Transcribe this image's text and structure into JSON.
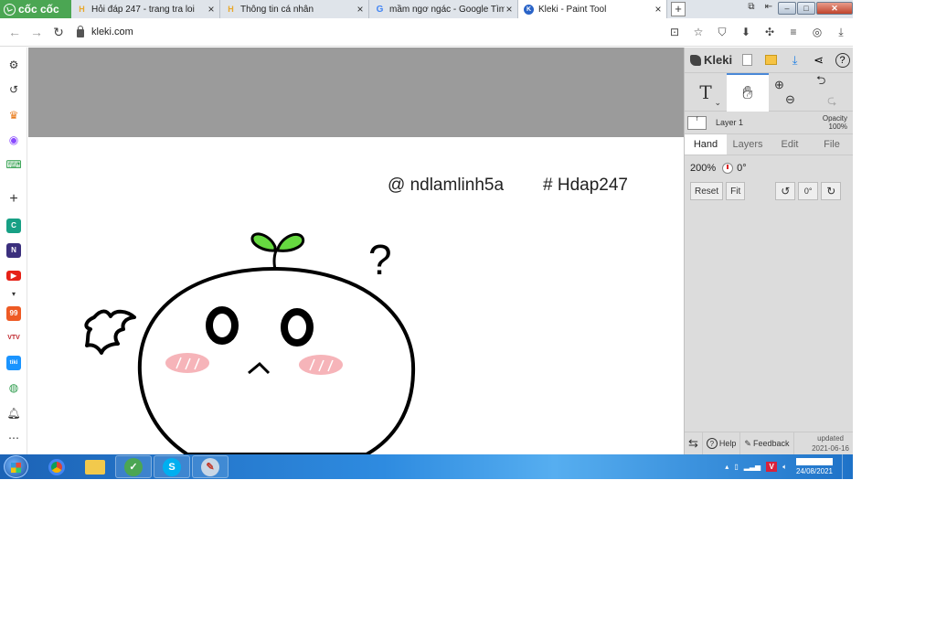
{
  "browser": {
    "brand": "cốc cốc",
    "tabs": [
      {
        "title": "Hỏi đáp 247 - trang tra loi",
        "favicon": "hoidap-icon",
        "active": false
      },
      {
        "title": "Thông tin cá nhân",
        "favicon": "hoidap-icon",
        "active": false
      },
      {
        "title": "mầm ngơ ngác - Google Tìm",
        "favicon": "google-icon",
        "active": false
      },
      {
        "title": "Kleki - Paint Tool",
        "favicon": "kleki-icon",
        "active": true
      }
    ],
    "url": "kleki.com"
  },
  "canvas": {
    "signature_user": "@ ndlamlinh5a",
    "signature_tag": "# Hdap247",
    "question_mark": "?"
  },
  "kleki": {
    "app_name": "Kleki",
    "layer_name": "Layer 1",
    "opacity_label": "Opacity",
    "opacity_value": "100%",
    "tabs": [
      "Hand",
      "Layers",
      "Edit",
      "File"
    ],
    "active_tab": "Hand",
    "zoom": "200%",
    "rotation": "0°",
    "reset_label": "Reset",
    "fit_label": "Fit",
    "rotate_value": "0°",
    "help_label": "Help",
    "feedback_label": "Feedback",
    "updated_label": "updated",
    "updated_date": "2021-06-16"
  },
  "taskbar": {
    "date": "24/08/2021"
  },
  "colors": {
    "canvas_gray": "#9b9b9b",
    "panel_bg": "#dcdcdc",
    "sprout_green": "#66d940",
    "blush_pink": "#f5a7ad",
    "coccoc_green": "#4ba653"
  }
}
